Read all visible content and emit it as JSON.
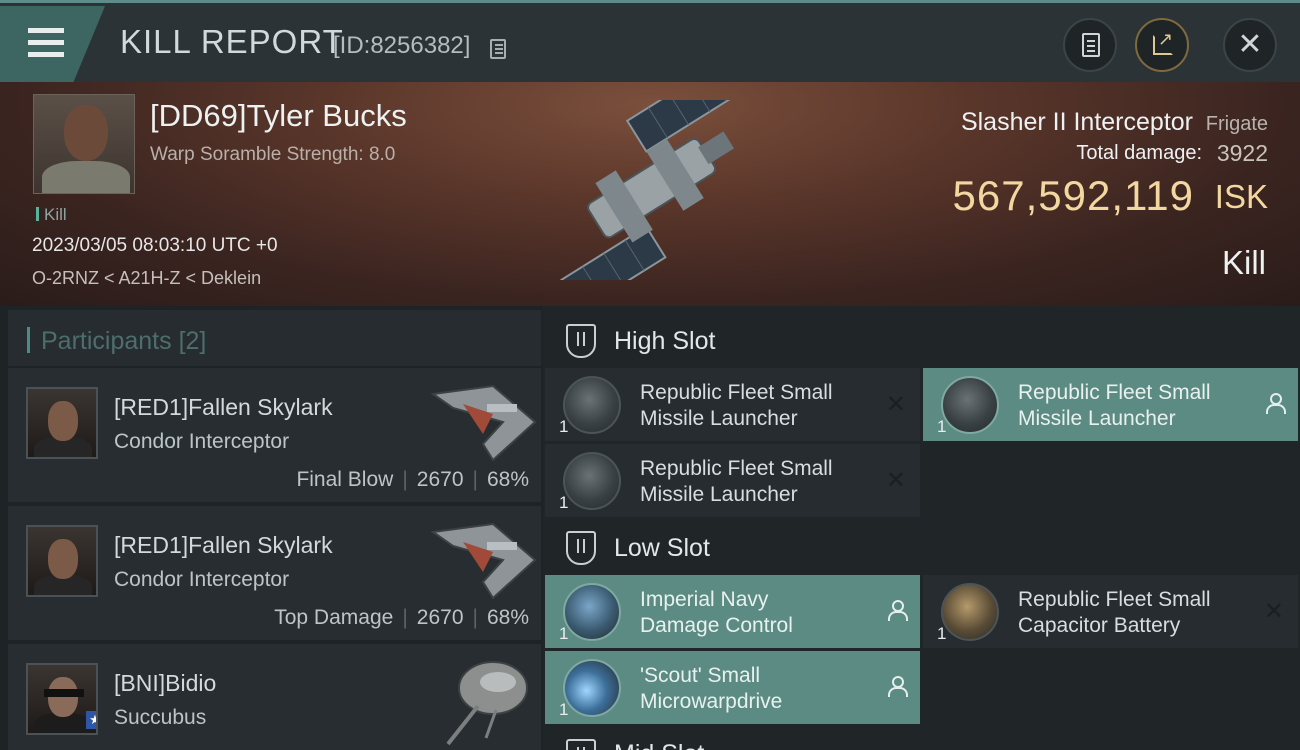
{
  "header": {
    "title": "KILL REPORT",
    "report_id": "[ID:8256382]"
  },
  "victim": {
    "name": "[DD69]Tyler Bucks",
    "scramble": "Warp Soramble Strength: 8.0",
    "tag": "Kill",
    "datetime": "2023/03/05 08:03:10 UTC +0",
    "location": "O-2RNZ < A21H-Z < Deklein",
    "ship_name": "Slasher II Interceptor",
    "ship_class": "Frigate",
    "damage_label": "Total damage:",
    "damage_value": "3922",
    "isk_value": "567,592,119",
    "isk_label": "ISK",
    "result": "Kill"
  },
  "participants": {
    "title": "Participants",
    "count": "[2]",
    "items": [
      {
        "name": "[RED1]Fallen Skylark",
        "ship": "Condor Interceptor",
        "role": "Final Blow",
        "damage": "2670",
        "percent": "68%"
      },
      {
        "name": "[RED1]Fallen Skylark",
        "ship": "Condor Interceptor",
        "role": "Top Damage",
        "damage": "2670",
        "percent": "68%"
      },
      {
        "name": "[BNI]Bidio",
        "ship": "Succubus"
      }
    ]
  },
  "fitting": {
    "high_slot_label": "High Slot",
    "low_slot_label": "Low Slot",
    "mid_slot_label": "Mid Slot",
    "high": [
      {
        "name": "Republic Fleet Small Missile Launcher",
        "line1": "Republic Fleet Small",
        "line2": "Missile Launcher",
        "qty": "1",
        "status": "destroyed-icon"
      },
      {
        "name": "Republic Fleet Small Missile Launcher",
        "line1": "Republic Fleet Small",
        "line2": "Missile Launcher",
        "qty": "1",
        "status": "dropped-icon"
      },
      {
        "name": "Republic Fleet Small Missile Launcher",
        "line1": "Republic Fleet Small",
        "line2": "Missile Launcher",
        "qty": "1",
        "status": "destroyed-icon"
      }
    ],
    "low": [
      {
        "line1": "Imperial Navy",
        "line2": "Damage Control",
        "qty": "1",
        "status": "dropped-icon"
      },
      {
        "line1": "Republic Fleet Small",
        "line2": "Capacitor Battery",
        "qty": "1",
        "status": "destroyed-icon"
      },
      {
        "line1": "'Scout' Small",
        "line2": "Microwarpdrive",
        "qty": "1",
        "status": "dropped-icon"
      }
    ],
    "destroyed_glyph": "✕"
  },
  "colors": {
    "accent": "#5b8b83",
    "isk_gold": "#f3d7a1",
    "header_bg": "#2c3336"
  }
}
